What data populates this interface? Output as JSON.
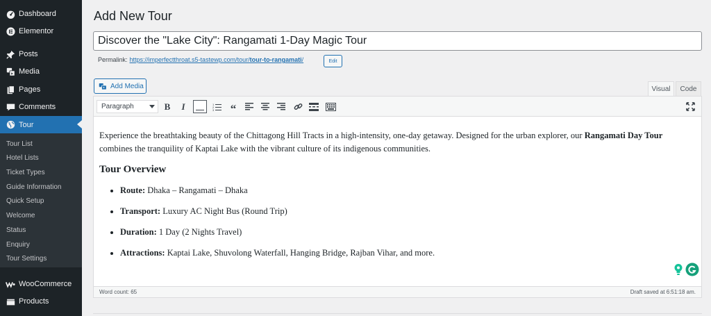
{
  "sidebar": {
    "items": [
      {
        "label": "Dashboard",
        "icon": "dashboard-icon"
      },
      {
        "label": "Elementor",
        "icon": "elementor-icon"
      },
      {
        "label": "Posts",
        "icon": "pin-icon"
      },
      {
        "label": "Media",
        "icon": "media-icon"
      },
      {
        "label": "Pages",
        "icon": "pages-icon"
      },
      {
        "label": "Comments",
        "icon": "comments-icon"
      },
      {
        "label": "Tour",
        "icon": "globe-icon",
        "active": true
      },
      {
        "label": "WooCommerce",
        "icon": "woocommerce-icon"
      },
      {
        "label": "Products",
        "icon": "products-icon"
      }
    ],
    "submenu": [
      "Tour List",
      "Hotel Lists",
      "Ticket Types",
      "Guide Information",
      "Quick Setup",
      "Welcome",
      "Status",
      "Enquiry",
      "Tour Settings"
    ],
    "active_color": "#2271b1"
  },
  "page": {
    "title": "Add New Tour"
  },
  "post": {
    "title": "Discover the \"Lake City\": Rangamati 1-Day Magic Tour",
    "permalink_label": "Permalink:",
    "permalink_base": "https://imperfectthroat.s5-tastewp.com/tour/",
    "permalink_slug": "tour-to-rangamati",
    "permalink_trail": "/",
    "edit_label": "Edit"
  },
  "editor": {
    "add_media_label": "Add Media",
    "tabs": [
      "Visual",
      "Code"
    ],
    "active_tab": "Visual",
    "format_select": "Paragraph",
    "toolbar": [
      "bold-icon",
      "italic-icon",
      "horizontal-line-icon",
      "ordered-list-icon",
      "blockquote-icon",
      "align-left-icon",
      "align-center-icon",
      "align-right-icon",
      "link-icon",
      "read-more-icon",
      "toolbar-toggle-icon",
      "fullscreen-icon"
    ],
    "content": {
      "intro_before": "Experience the breathtaking beauty of the Chittagong Hill Tracts in a high-intensity, one-day getaway. Designed for the urban explorer, our ",
      "intro_bold": "Rangamati Day Tour",
      "intro_after": " combines the tranquility of Kaptai Lake with the vibrant culture of its indigenous communities.",
      "heading": "Tour Overview",
      "list": [
        {
          "label": "Route:",
          "value": " Dhaka – Rangamati – Dhaka"
        },
        {
          "label": "Transport:",
          "value": " Luxury AC Night Bus (Round Trip)"
        },
        {
          "label": "Duration:",
          "value": " 1 Day (2 Nights Travel)"
        },
        {
          "label": "Attractions:",
          "value": " Kaptai Lake, Shuvolong Waterfall, Hanging Bridge, Rajban Vihar, and more."
        }
      ]
    },
    "word_count": "Word count: 65",
    "draft_saved": "Draft saved at 6:51:18 am."
  },
  "colors": {
    "admin_bar": "#1d2327",
    "submenu_bg": "#2c3338",
    "link": "#2271b1",
    "grammarly": "#15c39a"
  }
}
